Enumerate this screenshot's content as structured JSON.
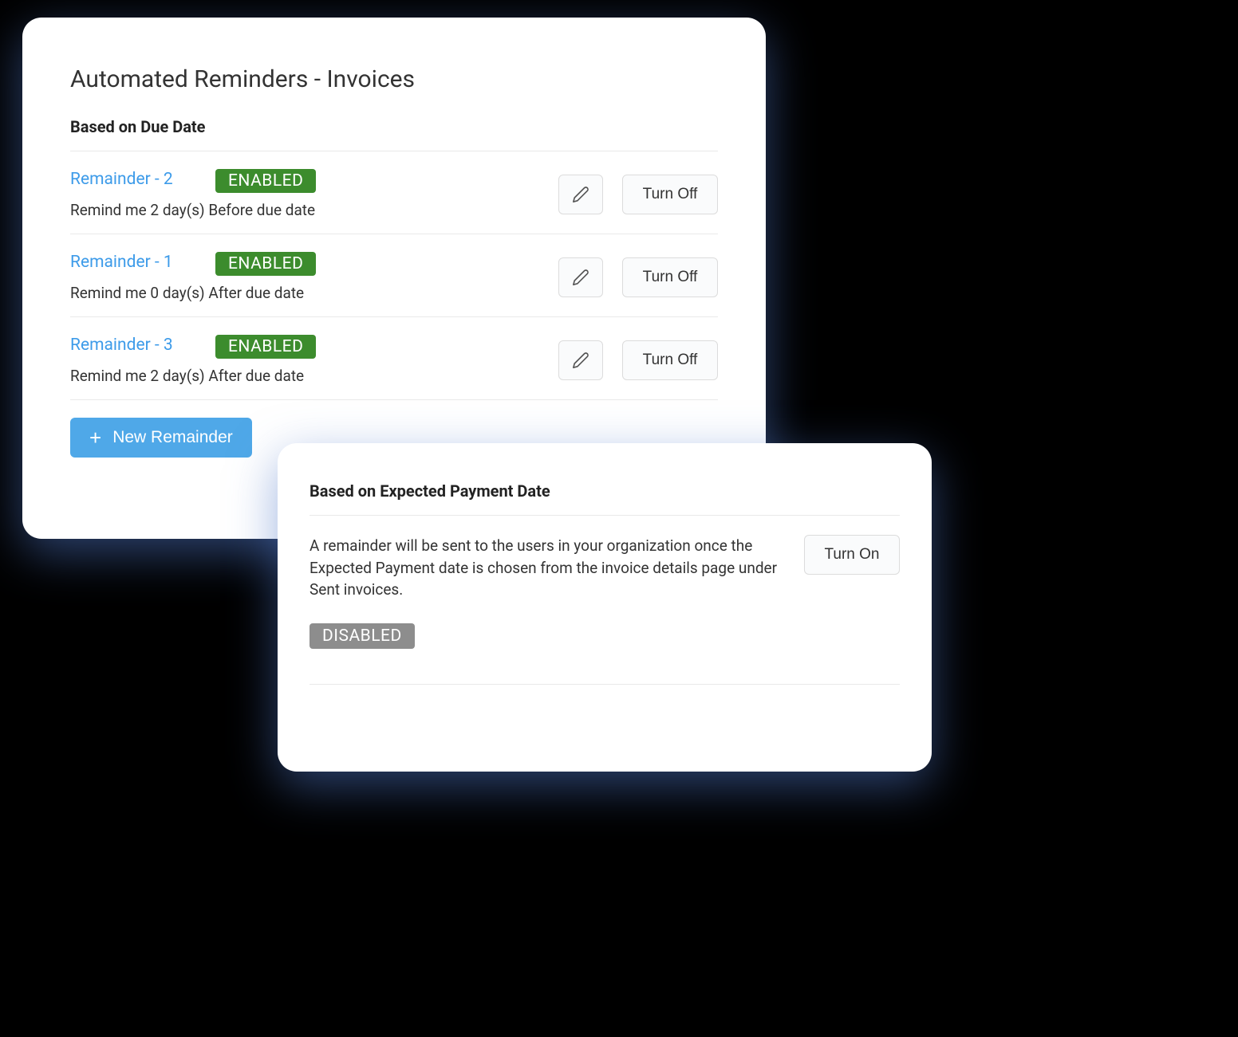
{
  "main": {
    "title": "Automated Reminders - Invoices",
    "section1_heading": "Based on Due Date",
    "reminders": [
      {
        "name": "Remainder - 2",
        "status": "ENABLED",
        "desc": "Remind me 2 day(s) Before due date",
        "toggle_label": "Turn Off"
      },
      {
        "name": "Remainder - 1",
        "status": "ENABLED",
        "desc": "Remind me 0 day(s) After due date",
        "toggle_label": "Turn Off"
      },
      {
        "name": "Remainder - 3",
        "status": "ENABLED",
        "desc": "Remind me 2 day(s) After due date",
        "toggle_label": "Turn Off"
      }
    ],
    "new_button_label": "New Remainder"
  },
  "secondary": {
    "heading": "Based on Expected Payment Date",
    "paragraph": "A remainder will be sent to the users in your organization once the Expected Payment date is chosen from the invoice details page under Sent invoices.",
    "toggle_label": "Turn On",
    "status": "DISABLED"
  }
}
